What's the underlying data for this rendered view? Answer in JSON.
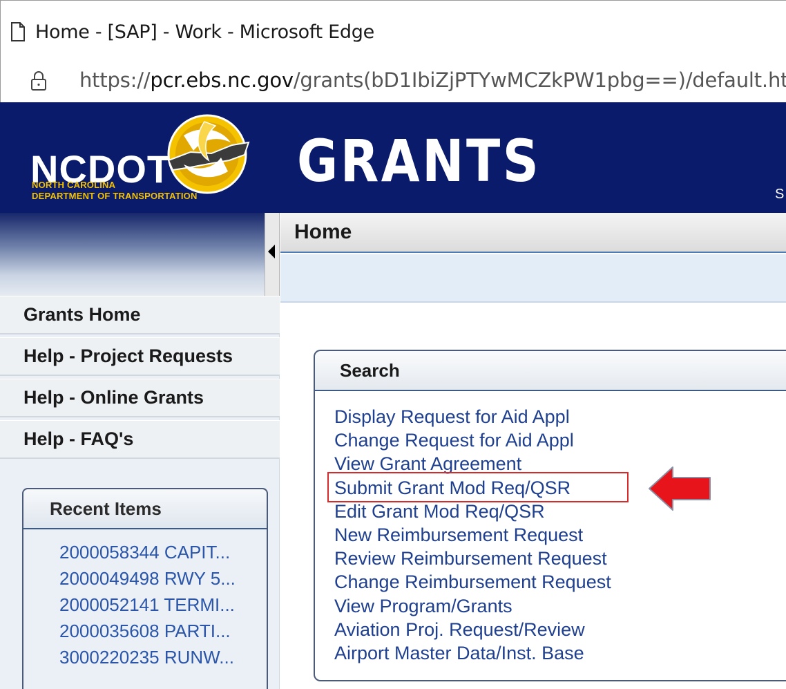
{
  "browser": {
    "window_title": "Home - [SAP] - Work - Microsoft Edge",
    "url_prefix": "https://",
    "url_domain": "pcr.ebs.nc.gov",
    "url_path": "/grants(bD1IbiZjPTYwMCZkPW1pbg==)/default.ht",
    "icons": [
      "page-icon",
      "lock-icon"
    ]
  },
  "banner": {
    "org_name": "NCDOT",
    "org_line1": "NORTH CAROLINA",
    "org_line2": "DEPARTMENT OF TRANSPORTATION",
    "app_title": "GRANTS",
    "right_fragment": "S",
    "colors": {
      "background": "#0b1b6b",
      "accent": "#f5c200"
    }
  },
  "sidebar": {
    "nav_items": [
      {
        "label": "Grants Home"
      },
      {
        "label": "Help - Project Requests"
      },
      {
        "label": "Help - Online Grants"
      },
      {
        "label": "Help - FAQ's"
      }
    ],
    "recent": {
      "title": "Recent Items",
      "items": [
        "2000058344 CAPIT...",
        "2000049498 RWY 5...",
        "2000052141 TERMI...",
        "2000035608 PARTI...",
        "3000220235 RUNW..."
      ]
    }
  },
  "main": {
    "page_title": "Home",
    "search": {
      "title": "Search",
      "links": [
        "Display Request for Aid Appl",
        "Change Request for Aid Appl",
        "View Grant Agreement",
        "Submit Grant Mod Req/QSR",
        "Edit Grant Mod Req/QSR",
        "New Reimbursement Request",
        "Review Reimbursement Request",
        "Change Reimbursement Request",
        "View Program/Grants",
        "Aviation Proj. Request/Review",
        "Airport Master Data/Inst. Base"
      ],
      "highlighted_link": "Submit Grant Mod Req/QSR"
    }
  },
  "annotation": {
    "highlight_color": "#d62b2b",
    "arrow_color": "#e8141b",
    "arrow_icon": "left-arrow-icon"
  }
}
